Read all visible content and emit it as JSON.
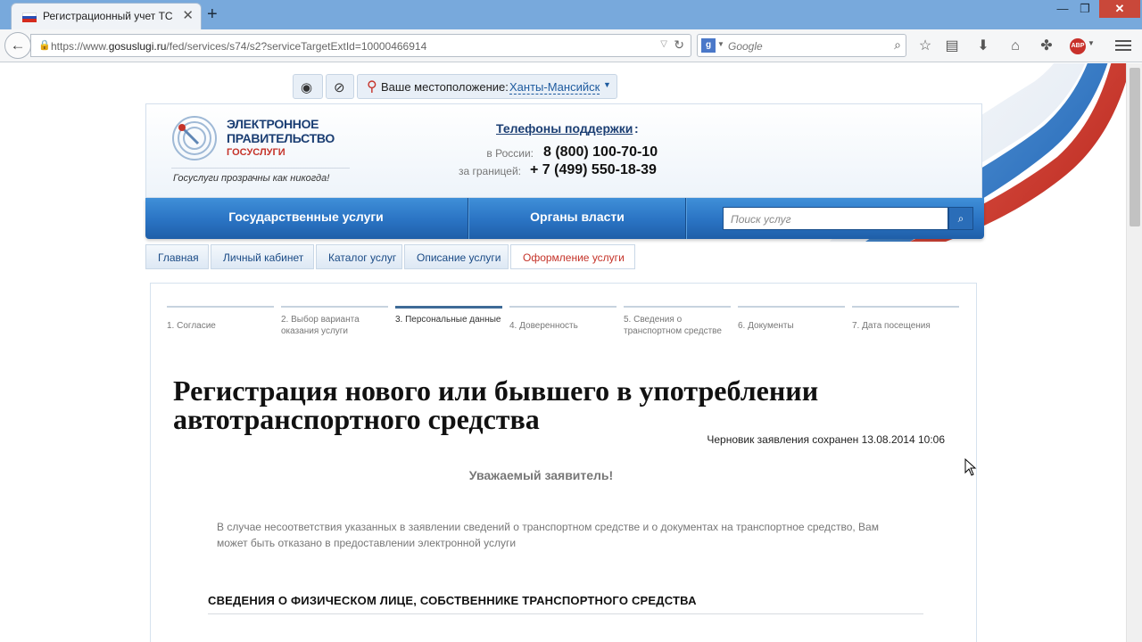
{
  "browser": {
    "tab_title": "Регистрационный учет ТС",
    "tab_close": "✕",
    "new_tab": "+",
    "url_prefix": "https://www.",
    "url_domain": "gosuslugi.ru",
    "url_path": "/fed/services/s74/s2?serviceTargetExtId=10000466914",
    "search_placeholder": "Google",
    "search_engine_icon": "google-icon"
  },
  "location_bar": {
    "label": "Ваше местоположение:",
    "city": "Ханты-Мансийск"
  },
  "header": {
    "logo_line1": "ЭЛЕКТРОННОЕ",
    "logo_line2": "ПРАВИТЕЛЬСТВО",
    "logo_line3": "ГОСУСЛУГИ",
    "slogan": "Госуслуги прозрачны как никогда!",
    "phones_title": "Телефоны поддержки",
    "phones_colon": ":",
    "russia_label": "в России:",
    "russia_phone": "8 (800) 100-70-10",
    "abroad_label": "за границей:",
    "abroad_phone": "+ 7 (499) 550-18-39"
  },
  "main_nav": {
    "item1": "Государственные услуги",
    "item2": "Органы власти",
    "search_placeholder": "Поиск услуг"
  },
  "breadcrumbs": [
    "Главная",
    "Личный кабинет",
    "Каталог услуг",
    "Описание услуги",
    "Оформление услуги"
  ],
  "steps": [
    {
      "label": "1. Согласие"
    },
    {
      "label": "2. Выбор варианта оказания услуги"
    },
    {
      "label": "3. Персональные данные",
      "active": true
    },
    {
      "label": "4. Доверенность"
    },
    {
      "label": "5. Сведения о транспортном средстве"
    },
    {
      "label": "6. Документы"
    },
    {
      "label": "7. Дата посещения"
    }
  ],
  "form": {
    "title": "Регистрация нового или бывшего в употреблении автотранспортного средства",
    "draft_status": "Черновик заявления сохранен 13.08.2014 10:06",
    "greeting": "Уважаемый заявитель!",
    "notice": "В случае несоответствия указанных в заявлении сведений о транспортном средстве и о документах на транспортное средство, Вам может быть отказано в предоставлении электронной услуги",
    "section_title": "СВЕДЕНИЯ О ФИЗИЧЕСКОМ ЛИЦЕ, СОБСТВЕННИКЕ ТРАНСПОРТНОГО СРЕДСТВА"
  },
  "colors": {
    "nav_blue": "#2a73c3",
    "brand_dark": "#1b3e73",
    "brand_red": "#c53329",
    "titlebar": "#78a9dc"
  }
}
